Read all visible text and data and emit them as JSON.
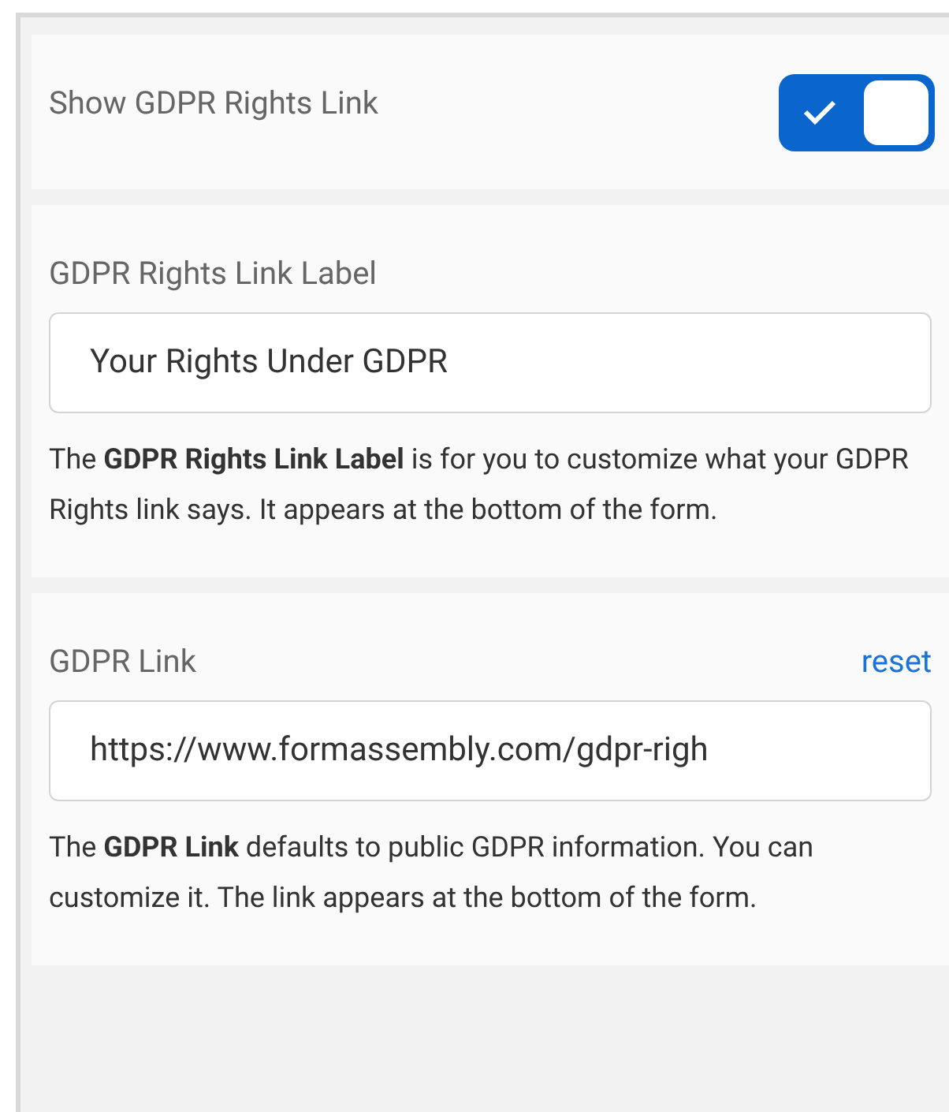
{
  "show_rights_link": {
    "label": "Show GDPR Rights Link",
    "on": true
  },
  "rights_link_label": {
    "label": "GDPR Rights Link Label",
    "value": "Your Rights Under GDPR",
    "description": "The **GDPR Rights Link Label** is for you to customize what your GDPR Rights link says. It appears at the bottom of the form."
  },
  "gdpr_link": {
    "label": "GDPR Link",
    "reset": "reset",
    "value": "https://www.formassembly.com/gdpr-righ",
    "description": "The **GDPR Link** defaults to public GDPR information. You can customize it. The link appears at the bottom of the form."
  }
}
